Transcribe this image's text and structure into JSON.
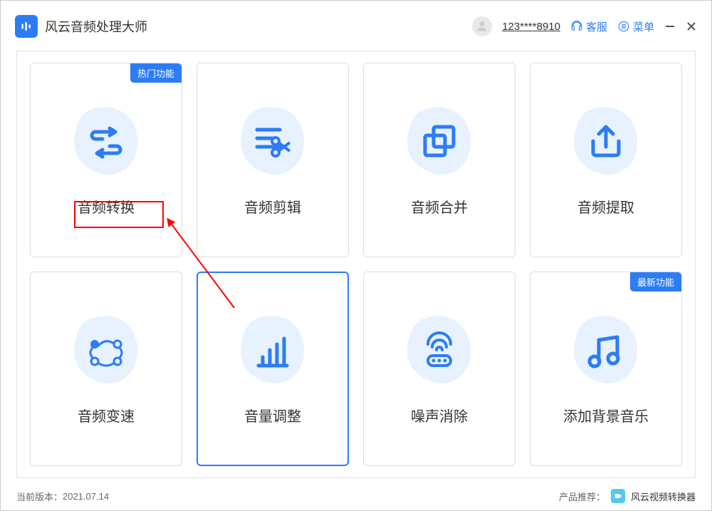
{
  "app": {
    "title": "风云音频处理大师",
    "user": "123****8910",
    "support": "客服",
    "menu": "菜单"
  },
  "cards": [
    {
      "title": "音频转换",
      "badge": "热门功能"
    },
    {
      "title": "音频剪辑",
      "badge": ""
    },
    {
      "title": "音频合并",
      "badge": ""
    },
    {
      "title": "音频提取",
      "badge": ""
    },
    {
      "title": "音频变速",
      "badge": ""
    },
    {
      "title": "音量调整",
      "badge": ""
    },
    {
      "title": "噪声消除",
      "badge": ""
    },
    {
      "title": "添加背景音乐",
      "badge": "最新功能"
    }
  ],
  "footer": {
    "version_label": "当前版本：",
    "version": "2021.07.14",
    "promo_label": "产品推荐：",
    "promo_name": "风云视频转换器"
  }
}
